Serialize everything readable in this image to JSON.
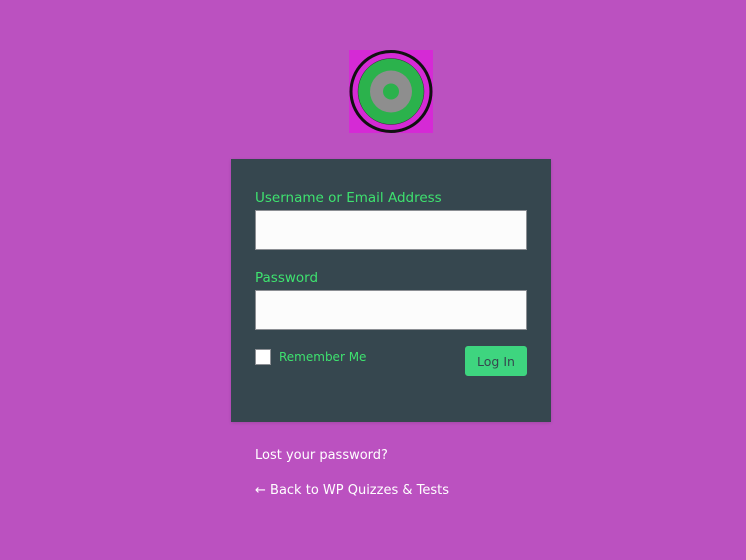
{
  "logo": {
    "icon": "target-logo-icon"
  },
  "form": {
    "username_label": "Username or Email Address",
    "username_value": "",
    "password_label": "Password",
    "password_value": "",
    "remember_label": "Remember Me",
    "remember_checked": false,
    "submit_label": "Log In"
  },
  "links": {
    "lost_password": "Lost your password?",
    "back_to_site": "← Back to WP Quizzes & Tests"
  },
  "colors": {
    "background": "#bb51c0",
    "panel": "#36474f",
    "accent": "#3ee26f",
    "button": "#3ed57f",
    "logo_background": "#d52ad5",
    "logo_ring_green": "#2bb24c",
    "logo_ring_gray": "#8e8e8e"
  }
}
